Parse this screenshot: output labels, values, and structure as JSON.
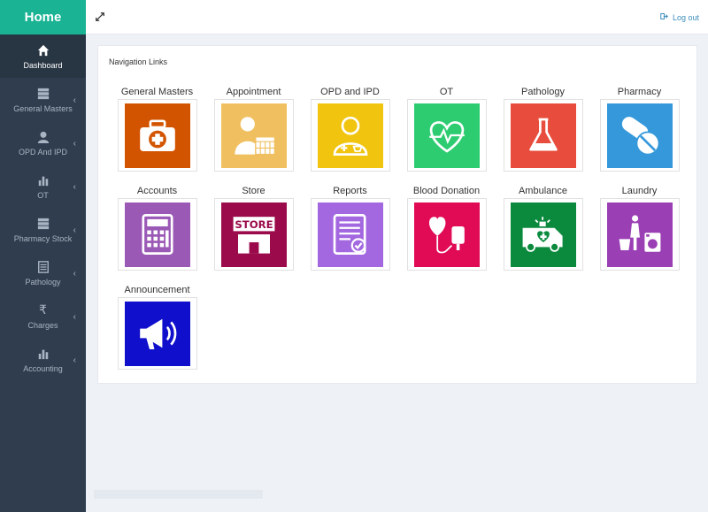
{
  "sidebar": {
    "brand": "Home",
    "items": [
      {
        "label": "Dashboard",
        "icon": "home-icon"
      },
      {
        "label": "General Masters",
        "icon": "server-icon"
      },
      {
        "label": "OPD And IPD",
        "icon": "user-icon"
      },
      {
        "label": "OT",
        "icon": "bar-chart-icon"
      },
      {
        "label": "Pharmacy Stock",
        "icon": "server-icon"
      },
      {
        "label": "Pathology",
        "icon": "list-icon"
      },
      {
        "label": "Charges",
        "icon": "rupee-icon"
      },
      {
        "label": "Accounting",
        "icon": "bar-chart-icon"
      }
    ]
  },
  "topbar": {
    "logout_label": "Log out"
  },
  "panel": {
    "title": "Navigation Links",
    "tiles": [
      {
        "label": "General Masters",
        "icon": "first-aid-kit-icon",
        "color": "#d35400"
      },
      {
        "label": "Appointment",
        "icon": "doctor-calendar-icon",
        "color": "#f0c060"
      },
      {
        "label": "OPD and IPD",
        "icon": "nurse-icon",
        "color": "#f1c40f"
      },
      {
        "label": "OT",
        "icon": "heart-pulse-icon",
        "color": "#2ecc71"
      },
      {
        "label": "Pathology",
        "icon": "flask-icon",
        "color": "#e74c3c"
      },
      {
        "label": "Pharmacy",
        "icon": "pills-icon",
        "color": "#3498db"
      },
      {
        "label": "Accounts",
        "icon": "calculator-icon",
        "color": "#9b59b6"
      },
      {
        "label": "Store",
        "icon": "store-icon",
        "color": "#9b0a4a",
        "store_text": "STORE"
      },
      {
        "label": "Reports",
        "icon": "report-icon",
        "color": "#a367e0"
      },
      {
        "label": "Blood Donation",
        "icon": "blood-bag-icon",
        "color": "#e00a55"
      },
      {
        "label": "Ambulance",
        "icon": "ambulance-icon",
        "color": "#0b8a3e"
      },
      {
        "label": "Laundry",
        "icon": "laundry-icon",
        "color": "#9b3fb5"
      },
      {
        "label": "Announcement",
        "icon": "megaphone-icon",
        "color": "#1010cc"
      }
    ]
  }
}
